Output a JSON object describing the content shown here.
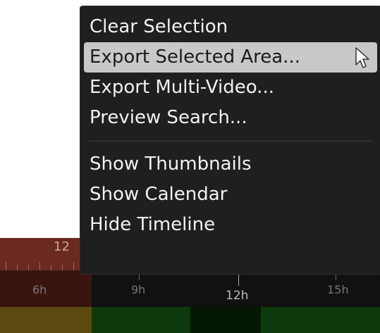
{
  "menu": {
    "items": [
      {
        "label": "Clear Selection"
      },
      {
        "label": "Export Selected Area..."
      },
      {
        "label": "Export Multi-Video..."
      },
      {
        "label": "Preview Search..."
      },
      {
        "label": "Show Thumbnails"
      },
      {
        "label": "Show Calendar"
      },
      {
        "label": "Hide Timeline"
      }
    ],
    "highlighted_index": 1
  },
  "timeline": {
    "top_label": "12",
    "hours": [
      "6h",
      "9h",
      "12h",
      "15h"
    ]
  },
  "colors": {
    "menu_bg": "#1f1f1f",
    "highlight_bg": "#c8c8c8",
    "timeline_red": "#4a1c16",
    "timeline_green": "#0c3a0c"
  }
}
